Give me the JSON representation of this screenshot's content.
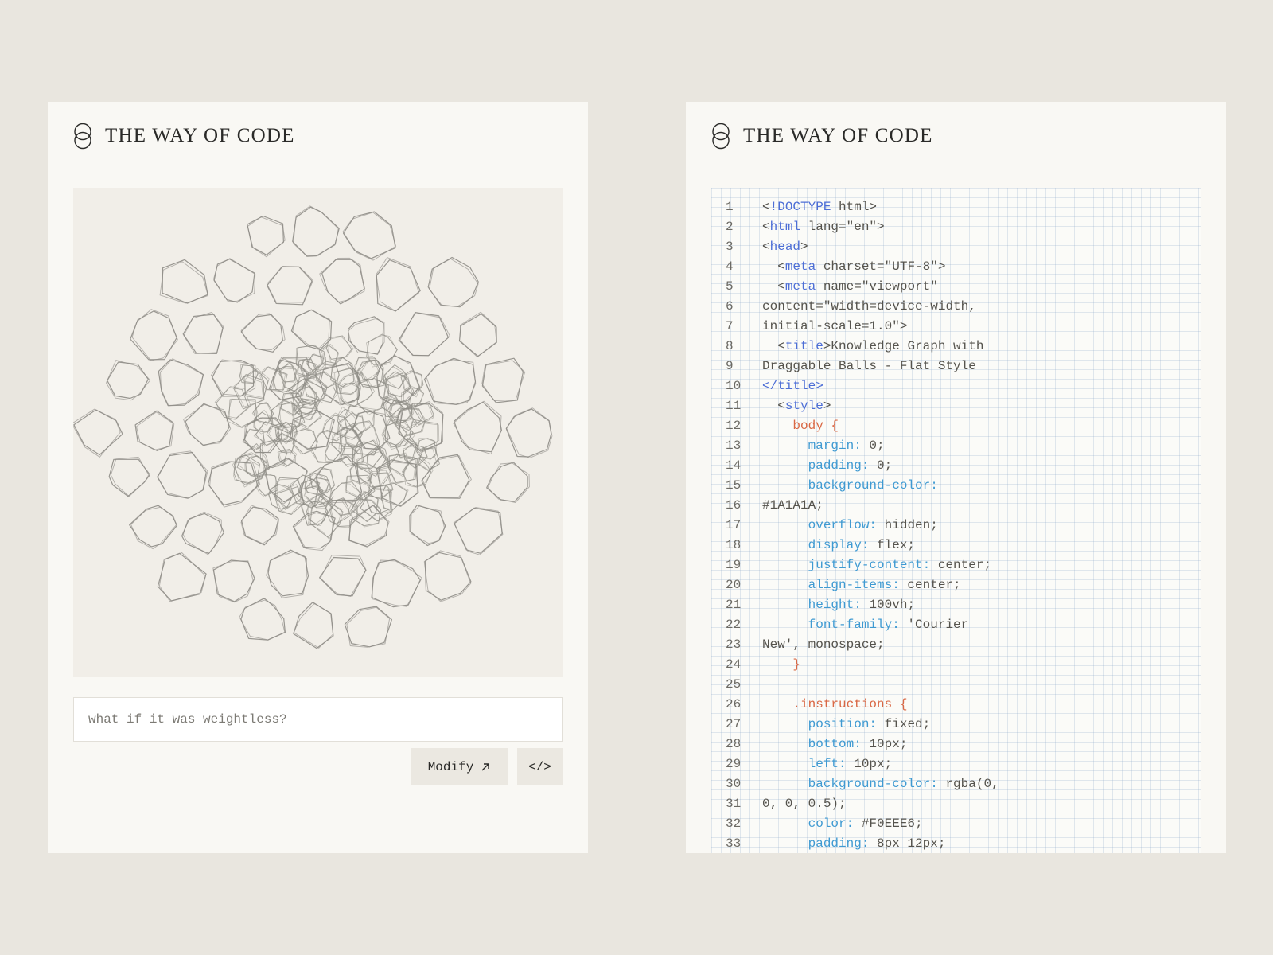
{
  "left_panel": {
    "brand": "THE WAY OF CODE",
    "prompt": {
      "placeholder": "what if it was weightless?",
      "value": ""
    },
    "modify_label": "Modify",
    "code_label": "</>"
  },
  "right_panel": {
    "brand": "THE WAY OF CODE",
    "code_lines": [
      {
        "n": "1",
        "tokens": [
          {
            "t": "<",
            "c": "plain"
          },
          {
            "t": "!DOCTYPE",
            "c": "tag"
          },
          {
            "t": " html>",
            "c": "plain"
          }
        ]
      },
      {
        "n": "2",
        "tokens": [
          {
            "t": "<",
            "c": "plain"
          },
          {
            "t": "html",
            "c": "tag"
          },
          {
            "t": " lang=\"en\">",
            "c": "plain"
          }
        ]
      },
      {
        "n": "3",
        "tokens": [
          {
            "t": "<",
            "c": "plain"
          },
          {
            "t": "head",
            "c": "tag"
          },
          {
            "t": ">",
            "c": "plain"
          }
        ]
      },
      {
        "n": "4",
        "tokens": [
          {
            "t": "  <",
            "c": "plain"
          },
          {
            "t": "meta",
            "c": "tag"
          },
          {
            "t": " charset=\"UTF-8\">",
            "c": "plain"
          }
        ]
      },
      {
        "n": "5",
        "tokens": [
          {
            "t": "  <",
            "c": "plain"
          },
          {
            "t": "meta",
            "c": "tag"
          },
          {
            "t": " name=\"viewport\"",
            "c": "plain"
          }
        ]
      },
      {
        "n": "6",
        "tokens": [
          {
            "t": "content=\"width=device-width,",
            "c": "plain"
          }
        ]
      },
      {
        "n": "7",
        "tokens": [
          {
            "t": "initial-scale=1.0\">",
            "c": "plain"
          }
        ]
      },
      {
        "n": "8",
        "tokens": [
          {
            "t": "  <",
            "c": "plain"
          },
          {
            "t": "title",
            "c": "tag"
          },
          {
            "t": ">Knowledge Graph with",
            "c": "plain"
          }
        ]
      },
      {
        "n": "9",
        "tokens": [
          {
            "t": "Draggable Balls - Flat Style",
            "c": "plain"
          }
        ]
      },
      {
        "n": "10",
        "tokens": [
          {
            "t": "</title>",
            "c": "tag"
          }
        ]
      },
      {
        "n": "11",
        "tokens": [
          {
            "t": "  <",
            "c": "plain"
          },
          {
            "t": "style",
            "c": "tag"
          },
          {
            "t": ">",
            "c": "plain"
          }
        ]
      },
      {
        "n": "12",
        "tokens": [
          {
            "t": "    body {",
            "c": "sel"
          }
        ]
      },
      {
        "n": "13",
        "tokens": [
          {
            "t": "      margin:",
            "c": "prop"
          },
          {
            "t": " 0;",
            "c": "plain"
          }
        ]
      },
      {
        "n": "14",
        "tokens": [
          {
            "t": "      padding:",
            "c": "prop"
          },
          {
            "t": " 0;",
            "c": "plain"
          }
        ]
      },
      {
        "n": "15",
        "tokens": [
          {
            "t": "      background-color:",
            "c": "prop"
          }
        ]
      },
      {
        "n": "16",
        "tokens": [
          {
            "t": "#1A1A1A;",
            "c": "plain"
          }
        ]
      },
      {
        "n": "17",
        "tokens": [
          {
            "t": "      overflow:",
            "c": "prop"
          },
          {
            "t": " hidden;",
            "c": "plain"
          }
        ]
      },
      {
        "n": "18",
        "tokens": [
          {
            "t": "      display:",
            "c": "prop"
          },
          {
            "t": " flex;",
            "c": "plain"
          }
        ]
      },
      {
        "n": "19",
        "tokens": [
          {
            "t": "      justify-content:",
            "c": "prop"
          },
          {
            "t": " center;",
            "c": "plain"
          }
        ]
      },
      {
        "n": "20",
        "tokens": [
          {
            "t": "      align-items:",
            "c": "prop"
          },
          {
            "t": " center;",
            "c": "plain"
          }
        ]
      },
      {
        "n": "21",
        "tokens": [
          {
            "t": "      height:",
            "c": "prop"
          },
          {
            "t": " 100vh;",
            "c": "plain"
          }
        ]
      },
      {
        "n": "22",
        "tokens": [
          {
            "t": "      font-family:",
            "c": "prop"
          },
          {
            "t": " 'Courier",
            "c": "plain"
          }
        ]
      },
      {
        "n": "23",
        "tokens": [
          {
            "t": "New', monospace;",
            "c": "plain"
          }
        ]
      },
      {
        "n": "24",
        "tokens": [
          {
            "t": "    }",
            "c": "sel"
          }
        ]
      },
      {
        "n": "25",
        "tokens": [
          {
            "t": "",
            "c": "plain"
          }
        ]
      },
      {
        "n": "26",
        "tokens": [
          {
            "t": "    .instructions {",
            "c": "sel"
          }
        ]
      },
      {
        "n": "27",
        "tokens": [
          {
            "t": "      position:",
            "c": "prop"
          },
          {
            "t": " fixed;",
            "c": "plain"
          }
        ]
      },
      {
        "n": "28",
        "tokens": [
          {
            "t": "      bottom:",
            "c": "prop"
          },
          {
            "t": " 10px;",
            "c": "plain"
          }
        ]
      },
      {
        "n": "29",
        "tokens": [
          {
            "t": "      left:",
            "c": "prop"
          },
          {
            "t": " 10px;",
            "c": "plain"
          }
        ]
      },
      {
        "n": "30",
        "tokens": [
          {
            "t": "      background-color:",
            "c": "prop"
          },
          {
            "t": " rgba(0,",
            "c": "plain"
          }
        ]
      },
      {
        "n": "31",
        "tokens": [
          {
            "t": "0, 0, 0.5);",
            "c": "plain"
          }
        ]
      },
      {
        "n": "32",
        "tokens": [
          {
            "t": "      color:",
            "c": "prop"
          },
          {
            "t": " #F0EEE6;",
            "c": "plain"
          }
        ]
      },
      {
        "n": "33",
        "tokens": [
          {
            "t": "      padding:",
            "c": "prop"
          },
          {
            "t": " 8px 12px;",
            "c": "plain"
          }
        ]
      }
    ]
  },
  "colors": {
    "background": "#e9e6df",
    "panel": "#f9f8f4",
    "canvas": "#f1eee8",
    "stroke": "#8e8c86",
    "code_tag": "#4d6ed6",
    "code_selector": "#d96845",
    "code_property": "#3f9ad2",
    "code_plain": "#55534d"
  },
  "icons": {
    "logo": "interlocking-rings-icon",
    "modify": "arrow-up-right-icon",
    "code": "code-brackets-icon"
  }
}
